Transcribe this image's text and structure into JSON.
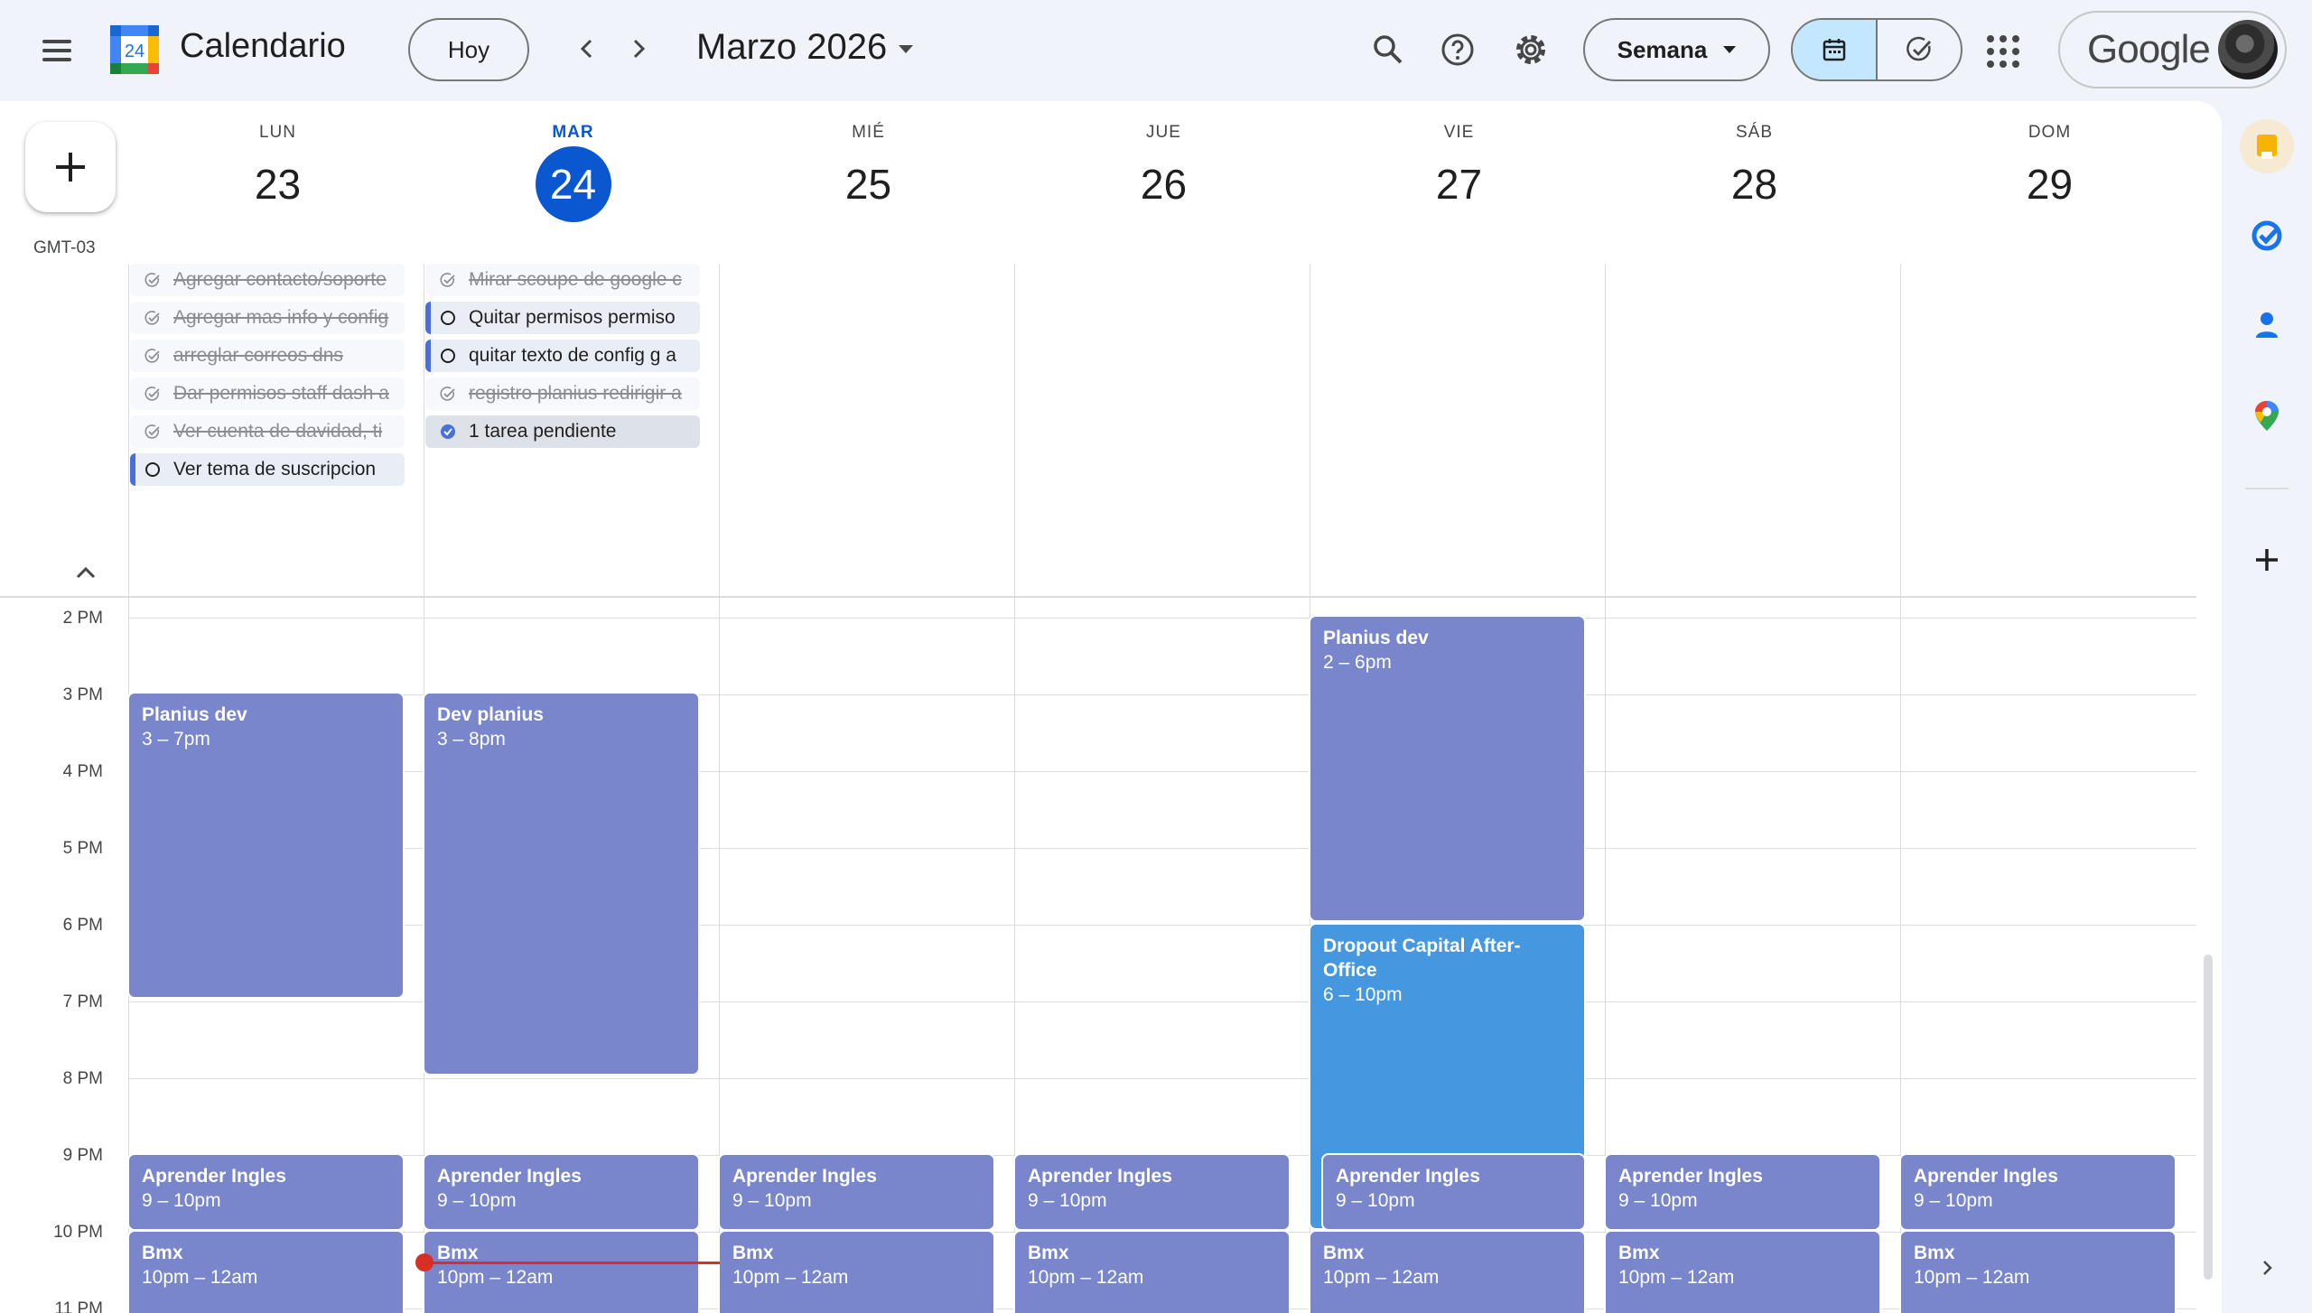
{
  "header": {
    "app_title": "Calendario",
    "logo_day": "24",
    "today_label": "Hoy",
    "month_title": "Marzo 2026",
    "view_label": "Semana",
    "account_brand": "Google",
    "icons": [
      "menu-icon",
      "chevron-left-icon",
      "chevron-right-icon",
      "search-icon",
      "help-icon",
      "settings-icon",
      "calendar-icon",
      "tasks-check-icon",
      "apps-grid-icon"
    ]
  },
  "timezone": "GMT-03",
  "days": [
    {
      "name": "LUN",
      "num": "23",
      "today": false
    },
    {
      "name": "MAR",
      "num": "24",
      "today": true
    },
    {
      "name": "MIÉ",
      "num": "25",
      "today": false
    },
    {
      "name": "JUE",
      "num": "26",
      "today": false
    },
    {
      "name": "VIE",
      "num": "27",
      "today": false
    },
    {
      "name": "SÁB",
      "num": "28",
      "today": false
    },
    {
      "name": "DOM",
      "num": "29",
      "today": false
    }
  ],
  "tasks": {
    "mon": [
      {
        "text": "Agregar contacto/soporte",
        "state": "done"
      },
      {
        "text": "Agregar mas info y config",
        "state": "done"
      },
      {
        "text": "arreglar correos dns",
        "state": "done"
      },
      {
        "text": "Dar permisos staff dash a",
        "state": "done"
      },
      {
        "text": "Ver cuenta de davidad, ti",
        "state": "done"
      },
      {
        "text": "Ver tema de suscripcion",
        "state": "open"
      }
    ],
    "tue": [
      {
        "text": "Mirar scoupe de google c",
        "state": "done"
      },
      {
        "text": "Quitar permisos permiso",
        "state": "open"
      },
      {
        "text": "quitar texto de config g a",
        "state": "open"
      },
      {
        "text": "registro planius redirigir a",
        "state": "done"
      },
      {
        "text": "1 tarea pendiente",
        "state": "pending"
      }
    ]
  },
  "hours": [
    "2 PM",
    "3 PM",
    "4 PM",
    "5 PM",
    "6 PM",
    "7 PM",
    "8 PM",
    "9 PM",
    "10 PM",
    "11 PM"
  ],
  "events": {
    "planius_dev_mon": {
      "title": "Planius dev",
      "time": "3 – 7pm"
    },
    "dev_planius_tue": {
      "title": "Dev planius",
      "time": "3 – 8pm"
    },
    "planius_dev_fri": {
      "title": "Planius dev",
      "time": "2 – 6pm"
    },
    "dropout_fri": {
      "title": "Dropout Capital After-Office",
      "time": "6 – 10pm"
    },
    "ingles": {
      "title": "Aprender Ingles",
      "time": "9 – 10pm"
    },
    "bmx": {
      "title": "Bmx",
      "time": "10pm – 12am"
    }
  },
  "colors": {
    "event_lavender": "#7986cb",
    "event_blue": "#4598e0",
    "today_accent": "#0b57d0",
    "now_indicator": "#d93025"
  }
}
